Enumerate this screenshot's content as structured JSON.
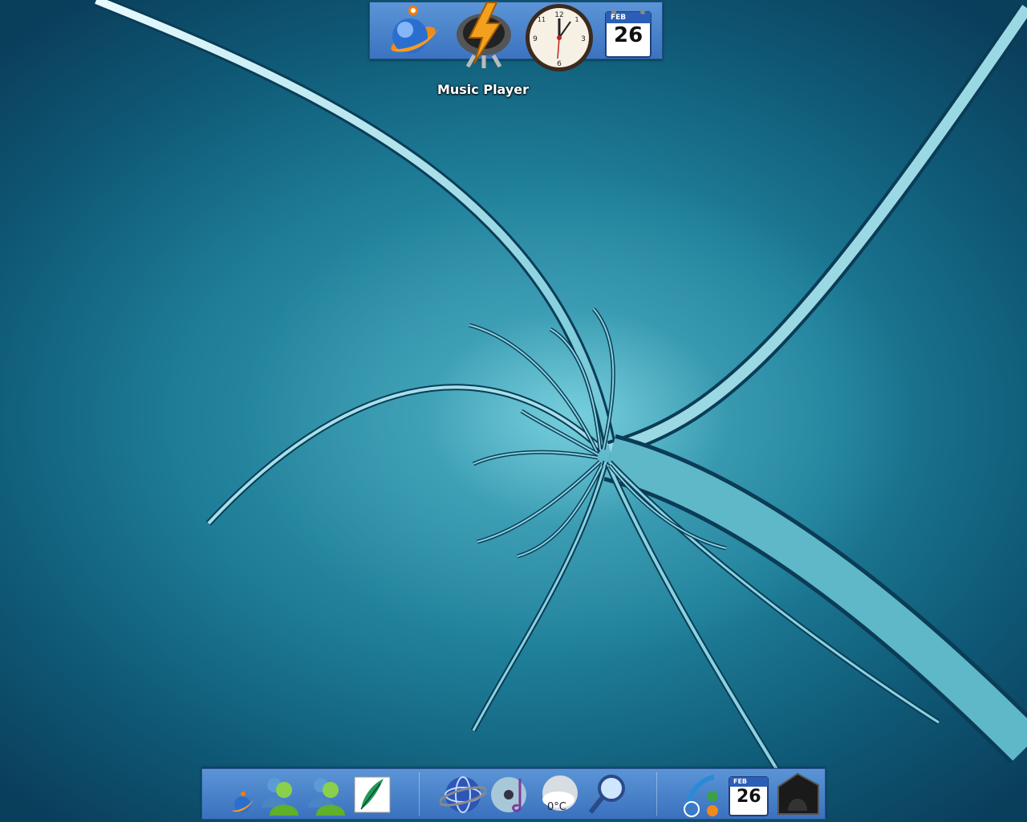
{
  "top_dock": {
    "hover_label": "Music Player",
    "items": [
      {
        "name": "browser-orb-icon"
      },
      {
        "name": "music-player-icon"
      },
      {
        "name": "clock-icon"
      },
      {
        "name": "calendar-icon",
        "month": "FEB",
        "day": "26"
      }
    ]
  },
  "bottom_dock": {
    "left_group": [
      {
        "name": "browser-orb-small-icon"
      },
      {
        "name": "messenger-icon"
      },
      {
        "name": "messenger-icon-2"
      },
      {
        "name": "feather-editor-icon"
      }
    ],
    "middle_group": [
      {
        "name": "globe-icon"
      },
      {
        "name": "media-disc-icon"
      },
      {
        "name": "weather-icon",
        "temperature": "0°C"
      },
      {
        "name": "magnifier-icon"
      }
    ],
    "right_group": [
      {
        "name": "settings-gear-icon"
      },
      {
        "name": "calendar-icon",
        "month": "FEB",
        "day": "26"
      },
      {
        "name": "dark-box-icon"
      }
    ]
  },
  "colors": {
    "dock_top": "#5b95d6",
    "dock_bottom": "#3b73c0",
    "wallpaper_dark": "#0a3f5c",
    "wallpaper_light": "#8ce1eb"
  }
}
